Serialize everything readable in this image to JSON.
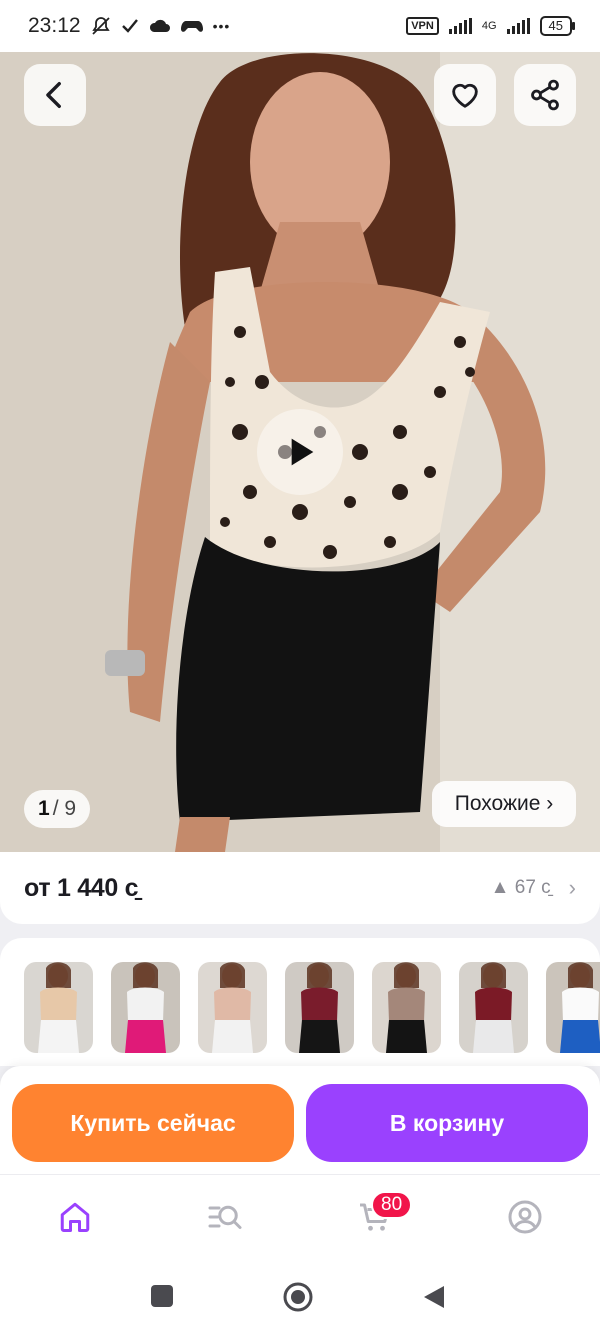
{
  "status_bar": {
    "time": "23:12",
    "dots": "•••",
    "vpn": "VPN",
    "network": "4G",
    "battery": "45"
  },
  "gallery": {
    "current": "1",
    "total": "/ 9",
    "similar_label": "Похожие ›"
  },
  "product": {
    "price": "от 1 440 с̱",
    "price_change": "▲ 67 с̱"
  },
  "variants": [
    {
      "top": "#e7c8a8",
      "bottom": "#f4f4f4",
      "bg": "#d9d6d1"
    },
    {
      "top": "#f2f2f2",
      "bottom": "#e01a78",
      "bg": "#c9c3bb"
    },
    {
      "top": "#e0b9a6",
      "bottom": "#f2f2f2",
      "bg": "#ddd8d2"
    },
    {
      "top": "#7a1c2c",
      "bottom": "#151515",
      "bg": "#cfcac4"
    },
    {
      "top": "#a4877a",
      "bottom": "#141414",
      "bg": "#dcd6cf"
    },
    {
      "top": "#7b1a26",
      "bottom": "#e9e9ea",
      "bg": "#d6d2cc"
    },
    {
      "top": "#fafafa",
      "bottom": "#1e5fc2",
      "bg": "#cbc4bb"
    }
  ],
  "actions": {
    "buy_now": "Купить сейчас",
    "add_to_cart": "В корзину"
  },
  "nav": {
    "cart_count": "80"
  },
  "colors": {
    "accent_purple": "#9a41fe",
    "accent_orange": "#ff8330",
    "badge_red": "#f1154a"
  }
}
